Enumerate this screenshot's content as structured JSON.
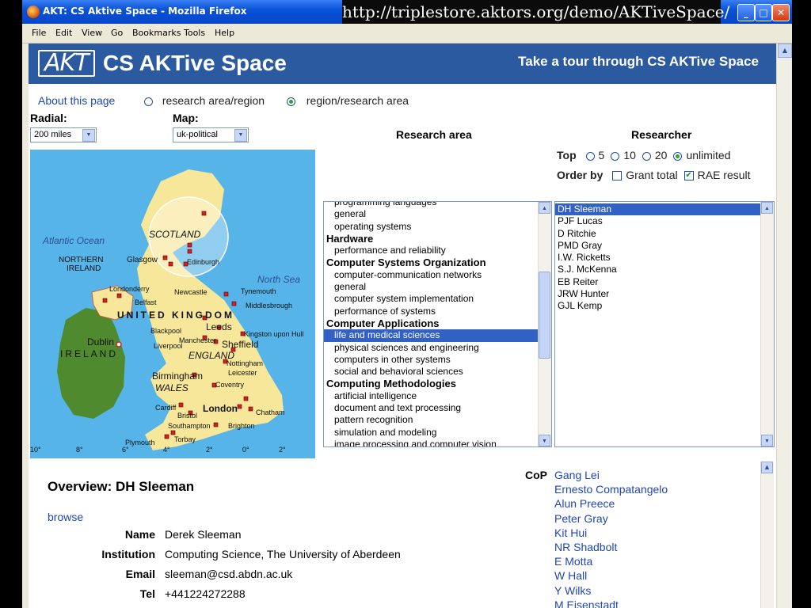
{
  "url_overlay": "http://triplestore.aktors.org/demo/AKTiveSpace/",
  "window": {
    "title": "AKT: CS Aktive Space - Mozilla Firefox"
  },
  "menu": [
    {
      "label": "File"
    },
    {
      "label": "Edit"
    },
    {
      "label": "View"
    },
    {
      "label": "Go"
    },
    {
      "label": "Bookmarks"
    },
    {
      "label": "Tools"
    },
    {
      "label": "Help"
    }
  ],
  "header": {
    "logo": "AKT",
    "title": "CS AKTive Space",
    "tour": "Take a tour through CS AKTive Space"
  },
  "nav": {
    "about": "About this page",
    "order_option_1": "research area/region",
    "order_option_2": "region/research area",
    "selected_order": "region/research area"
  },
  "controls": {
    "radial_label": "Radial:",
    "radial_value": "200 miles",
    "map_label": "Map:",
    "map_value": "uk-political"
  },
  "map": {
    "labels": {
      "atlantic": "Atlantic Ocean",
      "scotland": "SCOTLAND",
      "north_sea": "North Sea",
      "n_ireland_1": "NORTHERN",
      "n_ireland_2": "IRELAND",
      "glasgow": "Glasgow",
      "edinburgh": "Edinburgh",
      "londonderry": "Londonderry",
      "belfast": "Belfast",
      "newcastle": "Newcastle",
      "tynemouth": "Tynemouth",
      "middlesbrough": "Middlesbrough",
      "uk": "UNITED KINGDOM",
      "ireland": "IRELAND",
      "dublin": "Dublin",
      "blackpool": "Blackpool",
      "leeds": "Leeds",
      "kingston": "Kingston upon Hull",
      "manchester": "Manchester",
      "liverpool": "Liverpool",
      "sheffield": "Sheffield",
      "england": "ENGLAND",
      "nottingham": "Nottingham",
      "leicester": "Leicester",
      "birmingham": "Birmingham",
      "wales": "WALES",
      "coventry": "Coventry",
      "cardiff": "Cardiff",
      "bristol": "Bristol",
      "london": "London",
      "chatham": "Chatham",
      "southampton": "Southampton",
      "brighton": "Brighton",
      "plymouth": "Plymouth",
      "torbay": "Torbay",
      "tick_10": "10°",
      "tick_8": "8°",
      "tick_6": "6°",
      "tick_4": "4°",
      "tick_2w": "2°",
      "tick_0": "0°",
      "tick_2e": "2°"
    }
  },
  "research_area": {
    "heading": "Research area",
    "items": [
      {
        "label": "programming languages",
        "kind": "sub"
      },
      {
        "label": "general",
        "kind": "sub"
      },
      {
        "label": "operating systems",
        "kind": "sub"
      },
      {
        "label": "Hardware",
        "kind": "cat"
      },
      {
        "label": "performance and reliability",
        "kind": "sub"
      },
      {
        "label": "Computer Systems Organization",
        "kind": "cat"
      },
      {
        "label": "computer-communication networks",
        "kind": "sub"
      },
      {
        "label": "general",
        "kind": "sub"
      },
      {
        "label": "computer system implementation",
        "kind": "sub"
      },
      {
        "label": "performance of systems",
        "kind": "sub"
      },
      {
        "label": "Computer Applications",
        "kind": "cat"
      },
      {
        "label": "life and medical sciences",
        "kind": "sub",
        "selected": true
      },
      {
        "label": "physical sciences and engineering",
        "kind": "sub"
      },
      {
        "label": "computers in other systems",
        "kind": "sub"
      },
      {
        "label": "social and behavioral sciences",
        "kind": "sub"
      },
      {
        "label": "Computing Methodologies",
        "kind": "cat"
      },
      {
        "label": "artificial intelligence",
        "kind": "sub"
      },
      {
        "label": "document and text processing",
        "kind": "sub"
      },
      {
        "label": "pattern recognition",
        "kind": "sub"
      },
      {
        "label": "simulation and modeling",
        "kind": "sub"
      },
      {
        "label": "image processing and computer vision",
        "kind": "sub"
      }
    ]
  },
  "researcher": {
    "heading": "Researcher",
    "top_label": "Top",
    "top_options": [
      "5",
      "10",
      "20",
      "unlimited"
    ],
    "top_selected": "unlimited",
    "order_label": "Order by",
    "order_options": [
      {
        "label": "Grant total",
        "checked": false
      },
      {
        "label": "RAE result",
        "checked": true
      }
    ],
    "items": [
      "DH Sleeman",
      "PJF Lucas",
      "D Ritchie",
      "PMD Gray",
      "I.W. Ricketts",
      "S.J. McKenna",
      "EB Reiter",
      "JRW Hunter",
      "GJL Kemp"
    ],
    "selected": "DH Sleeman"
  },
  "overview": {
    "title": "Overview: DH Sleeman",
    "browse": "browse",
    "fields": [
      {
        "label": "Name",
        "value": "Derek Sleeman"
      },
      {
        "label": "Institution",
        "value": "Computing Science, The University of Aberdeen"
      },
      {
        "label": "Email",
        "value": "sleeman@csd.abdn.ac.uk"
      },
      {
        "label": "Tel",
        "value": "+441224272288"
      }
    ]
  },
  "cop": {
    "label": "CoP",
    "items": [
      "Gang Lei",
      "Ernesto Compatangelo",
      "Alun Preece",
      "Peter Gray",
      "Kit Hui",
      "NR Shadbolt",
      "E Motta",
      "W Hall",
      "Y Wilks",
      "M Eisenstadt"
    ]
  },
  "colors": {
    "header_bg": "#2c5aa0",
    "selection": "#3161c4",
    "link": "#2047b0",
    "land_uk": "#f7e79a",
    "land_ireland": "#4f8a2f",
    "sea": "#56b4e9"
  }
}
